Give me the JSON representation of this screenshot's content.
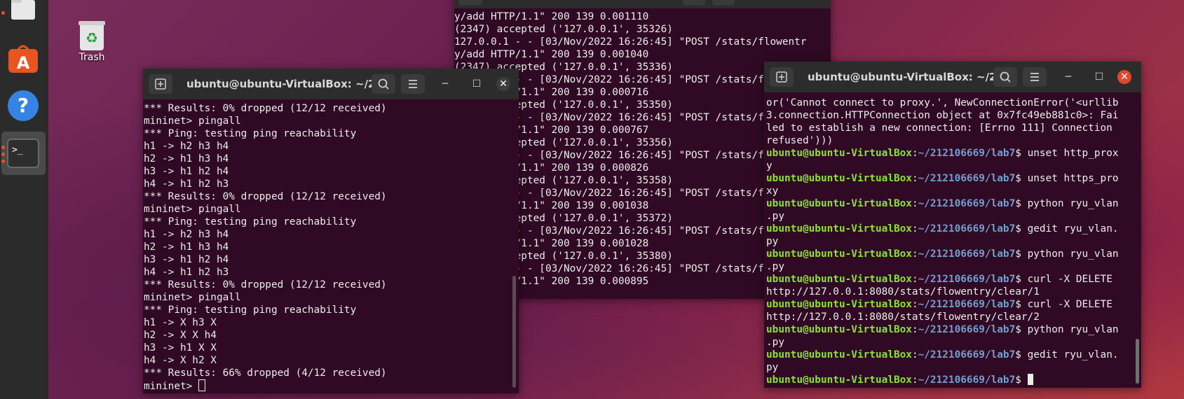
{
  "desktop": {
    "trash_label": "Trash"
  },
  "windows": {
    "middle": {
      "lines": [
        "y/add HTTP/1.1\" 200 139 0.001110",
        "(2347) accepted ('127.0.0.1', 35326)",
        "127.0.0.1 - - [03/Nov/2022 16:26:45] \"POST /stats/flowentr",
        "y/add HTTP/1.1\" 200 139 0.001040",
        "(2347) accepted ('127.0.0.1', 35336)",
        "127.0.0.1 - - [03/Nov/2022 16:26:45] \"POST /stats/flowentr",
        "y/add HTTP/1.1\" 200 139 0.000716",
        "(2347) accepted ('127.0.0.1', 35350)",
        "127.0.0.1 - - [03/Nov/2022 16:26:45] \"POST /stats/flowentr",
        "y/add HTTP/1.1\" 200 139 0.000767",
        "(2347) accepted ('127.0.0.1', 35356)",
        "127.0.0.1 - - [03/Nov/2022 16:26:45] \"POST /stats/flowentr",
        "y/add HTTP/1.1\" 200 139 0.000826",
        "(2347) accepted ('127.0.0.1', 35358)",
        "127.0.0.1 - - [03/Nov/2022 16:26:45] \"POST /stats/flowentr",
        "y/add HTTP/1.1\" 200 139 0.001038",
        "(2347) accepted ('127.0.0.1', 35372)",
        "127.0.0.1 - - [03/Nov/2022 16:26:45] \"POST /stats/flowentr",
        "y/add HTTP/1.1\" 200 139 0.001028",
        "(2347) accepted ('127.0.0.1', 35380)",
        "127.0.0.1 - - [03/Nov/2022 16:26:45] \"POST /stats/flowentr",
        "y/add HTTP/1.1\" 200 139 0.000895"
      ]
    },
    "left": {
      "title": "ubuntu@ubuntu-VirtualBox: ~/2...",
      "lines": [
        "*** Results: 0% dropped (12/12 received)",
        "mininet> pingall",
        "*** Ping: testing ping reachability",
        "h1 -> h2 h3 h4",
        "h2 -> h1 h3 h4",
        "h3 -> h1 h2 h4",
        "h4 -> h1 h2 h3",
        "*** Results: 0% dropped (12/12 received)",
        "mininet> pingall",
        "*** Ping: testing ping reachability",
        "h1 -> h2 h3 h4",
        "h2 -> h1 h3 h4",
        "h3 -> h1 h2 h4",
        "h4 -> h1 h2 h3",
        "*** Results: 0% dropped (12/12 received)",
        "mininet> pingall",
        "*** Ping: testing ping reachability",
        "h1 -> X h3 X",
        "h2 -> X X h4",
        "h3 -> h1 X X",
        "h4 -> X h2 X",
        "*** Results: 66% dropped (4/12 received)",
        "mininet> "
      ]
    },
    "right": {
      "title": "ubuntu@ubuntu-VirtualBox: ~/2...",
      "prompt_user": "ubuntu@ubuntu-VirtualBox",
      "prompt_path": "~/212106669/lab7",
      "pre_lines": [
        "or('Cannot connect to proxy.', NewConnectionError('<urllib",
        "3.connection.HTTPConnection object at 0x7fc49eb881c0>: Fai",
        "led to establish a new connection: [Errno 111] Connection",
        "refused')))"
      ],
      "commands": [
        {
          "cmd": "unset http_prox",
          "cont": "y"
        },
        {
          "cmd": "unset https_pro",
          "cont": "xy"
        },
        {
          "cmd": "python ryu_vlan",
          "cont": ".py"
        },
        {
          "cmd": "gedit ryu_vlan.",
          "cont": "py"
        },
        {
          "cmd": "python ryu_vlan",
          "cont": ".py"
        },
        {
          "cmd": "curl -X DELETE",
          "cont": "http://127.0.0.1:8080/stats/flowentry/clear/1"
        },
        {
          "cmd": "curl -X DELETE",
          "cont": "http://127.0.0.1:8080/stats/flowentry/clear/2"
        },
        {
          "cmd": "python ryu_vlan",
          "cont": ".py"
        },
        {
          "cmd": "gedit ryu_vlan.",
          "cont": "py"
        },
        {
          "cmd": "",
          "cont": null
        }
      ]
    }
  },
  "colors": {
    "terminal_bg": "#300a24",
    "prompt_user": "#8ae234",
    "prompt_path": "#729fcf",
    "close_active": "#e2462f"
  },
  "icons": [
    "files-icon",
    "app-store-icon",
    "help-icon",
    "terminal-icon",
    "trash-icon",
    "new-tab-icon",
    "search-icon",
    "hamburger-menu-icon",
    "minimize-icon",
    "maximize-icon",
    "close-icon"
  ]
}
